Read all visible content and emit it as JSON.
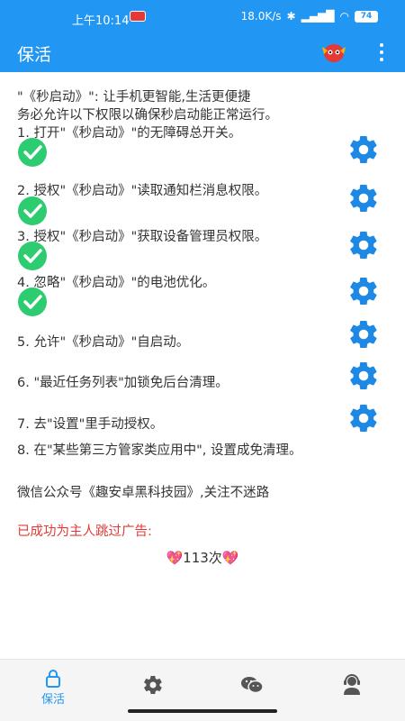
{
  "status_bar": {
    "time": "上午10:14",
    "network_speed": "18.0K/s",
    "battery": "74"
  },
  "app_bar": {
    "title": "保活"
  },
  "instructions": {
    "intro_1": "\"《秒启动》\": 让手机更智能,生活更便捷",
    "intro_2": "务必允许以下权限以确保秒启动能正常运行。",
    "step1": "1. 打开\"《秒启动》\"的无障碍总开关。",
    "step2": "2. 授权\"《秒启动》\"读取通知栏消息权限。",
    "step3": "3. 授权\"《秒启动》\"获取设备管理员权限。",
    "step4": "4. 忽略\"《秒启动》\"的电池优化。",
    "step5": "5. 允许\"《秒启动》\"自启动。",
    "step6": "6. \"最近任务列表\"加锁免后台清理。",
    "step7": "7. 去\"设置\"里手动授权。",
    "step8": "8. 在\"某些第三方管家类应用中\", 设置成免清理。"
  },
  "wechat_note": "微信公众号《趣安卓黑科技园》,关注不迷路",
  "ad_skip_label": "已成功为主人跳过广告:",
  "ad_skip_count": "113次",
  "nav": {
    "tab1_label": "保活"
  },
  "colors": {
    "primary": "#2196F3",
    "check": "#2ecc71",
    "red_text": "#e53935"
  }
}
